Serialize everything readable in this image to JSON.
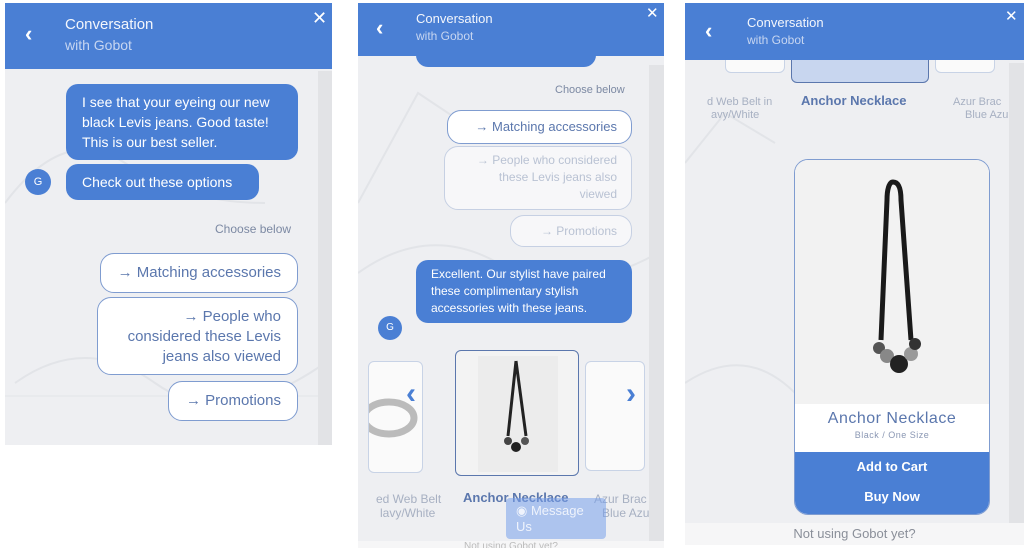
{
  "header": {
    "title": "Conversation",
    "subtitle": "with Gobot",
    "back_icon": "‹",
    "close_icon": "✕"
  },
  "avatar_initial": "G",
  "panel1": {
    "bot_message": "I see that your eyeing our new black Levis jeans. Good taste! This is our best seller.",
    "bot_message_2": "Check out these options",
    "choose_label": "Choose below",
    "options": [
      {
        "label": "→ Matching accessories"
      },
      {
        "label": "→ People who considered these Levis jeans also viewed"
      },
      {
        "label": "→ Promotions"
      }
    ]
  },
  "panel2": {
    "choose_label": "Choose below",
    "options": [
      {
        "label": "→ Matching accessories"
      },
      {
        "label": "→ People who considered these Levis jeans also viewed"
      },
      {
        "label": "→ Promotions"
      }
    ],
    "bot_message": "Excellent. Our stylist have paired these complimentary stylish accessories with these jeans.",
    "carousel": {
      "prev_icon": "‹",
      "next_icon": "›",
      "items": [
        {
          "name_line1": "ed Web Belt",
          "name_line2": "lavy/White"
        },
        {
          "name_line1": "Anchor Necklace",
          "name_line2": ""
        },
        {
          "name_line1": "Azur Brac",
          "name_line2": "Blue Azu"
        }
      ]
    },
    "message_us": "Message Us",
    "footer": "Not using Gobot yet?"
  },
  "panel3": {
    "carousel_captions": [
      {
        "name_line1": "d Web Belt in",
        "name_line2": "avy/White"
      },
      {
        "name_line1": "Anchor Necklace",
        "name_line2": ""
      },
      {
        "name_line1": "Azur Brac",
        "name_line2": "Blue Azu"
      }
    ],
    "product": {
      "name": "Anchor Necklace",
      "variant": "Black / One Size",
      "add_to_cart": "Add to Cart",
      "buy_now": "Buy Now"
    },
    "footer": "Not using Gobot yet?"
  },
  "colors": {
    "brand": "#4a7fd4",
    "option_text": "#5b77ad",
    "panel_bg": "#eeeff2"
  }
}
